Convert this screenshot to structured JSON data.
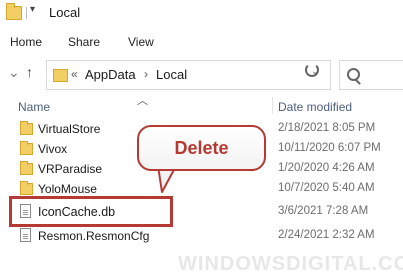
{
  "window": {
    "title": "Local",
    "quick_access": "▾"
  },
  "ribbon": {
    "tabs": [
      "Home",
      "Share",
      "View"
    ]
  },
  "address": {
    "overflow": "«",
    "segments": [
      "AppData",
      "Local"
    ],
    "sep": "›"
  },
  "columns": {
    "name": "Name",
    "date": "Date modified"
  },
  "files": [
    {
      "name": "VirtualStore",
      "date": "2/18/2021 8:05 PM",
      "type": "folder"
    },
    {
      "name": "Vivox",
      "date": "10/11/2020 6:07 PM",
      "type": "folder"
    },
    {
      "name": "VRParadise",
      "date": "1/20/2020 4:26 AM",
      "type": "folder"
    },
    {
      "name": "YoloMouse",
      "date": "10/7/2020 5:40 AM",
      "type": "folder"
    },
    {
      "name": "IconCache.db",
      "date": "3/6/2021 7:28 AM",
      "type": "file"
    },
    {
      "name": "Resmon.ResmonCfg",
      "date": "2/24/2021 2:32 AM",
      "type": "file"
    }
  ],
  "callout": {
    "text": "Delete"
  },
  "watermark": "WINDOWSDIGITAL.COM",
  "colors": {
    "accent": "#b53a34",
    "folder": "#f2cf65"
  }
}
